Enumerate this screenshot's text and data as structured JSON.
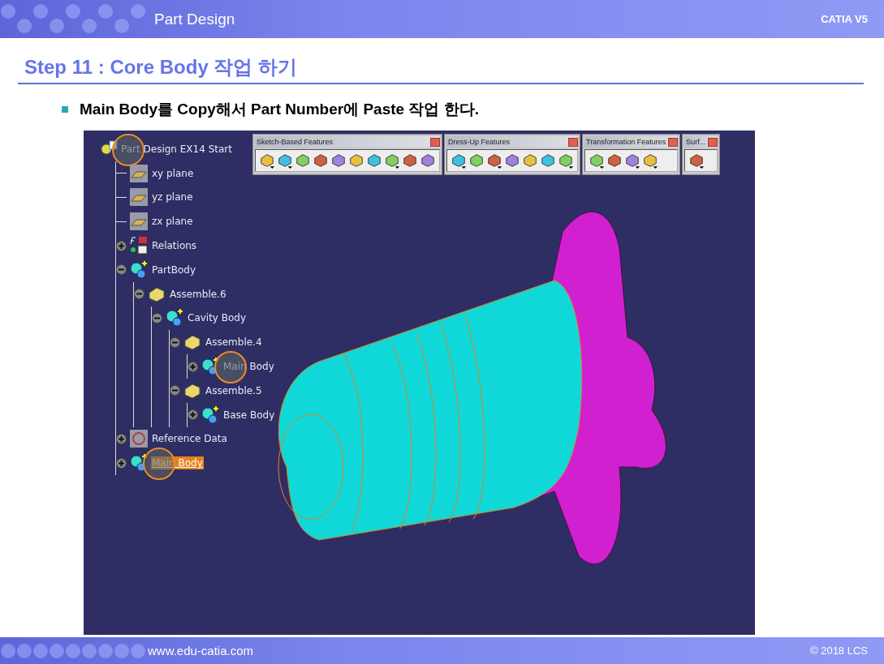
{
  "header": {
    "title": "Part Design",
    "product": "CATIA V5"
  },
  "step_title": "Step 11 : Core Body 작업 하기",
  "bullet": "Main Body를 Copy해서 Part Number에 Paste 작업 한다.",
  "toolbars": [
    {
      "title": "Sketch-Based Features",
      "tools": [
        {
          "dropdown": true
        },
        {
          "dropdown": true
        },
        {
          "dropdown": false
        },
        {
          "dropdown": false
        },
        {
          "dropdown": false
        },
        {
          "dropdown": false
        },
        {
          "dropdown": false
        },
        {
          "dropdown": true
        },
        {
          "dropdown": false
        },
        {
          "dropdown": false
        }
      ]
    },
    {
      "title": "Dress-Up Features",
      "tools": [
        {
          "dropdown": true
        },
        {
          "dropdown": false
        },
        {
          "dropdown": true
        },
        {
          "dropdown": false
        },
        {
          "dropdown": false
        },
        {
          "dropdown": false
        },
        {
          "dropdown": true
        }
      ]
    },
    {
      "title": "Transformation Features",
      "tools": [
        {
          "dropdown": true
        },
        {
          "dropdown": false
        },
        {
          "dropdown": true
        },
        {
          "dropdown": true
        }
      ]
    },
    {
      "title": "Surf...",
      "tools": [
        {
          "dropdown": true
        }
      ]
    }
  ],
  "tree": {
    "label": "Part Design EX14 Start",
    "kind": "part",
    "circled": true,
    "selected": false,
    "children": [
      {
        "label": "xy plane",
        "kind": "plane",
        "circled": false,
        "selected": false
      },
      {
        "label": "yz plane",
        "kind": "plane",
        "circled": false,
        "selected": false
      },
      {
        "label": "zx plane",
        "kind": "plane",
        "circled": false,
        "selected": false
      },
      {
        "label": "Relations",
        "kind": "relations",
        "expanded": false,
        "circled": false,
        "selected": false
      },
      {
        "label": "PartBody",
        "kind": "body",
        "expanded": true,
        "circled": false,
        "selected": false,
        "children": [
          {
            "label": "Assemble.6",
            "kind": "assemble",
            "expanded": true,
            "circled": false,
            "selected": false,
            "children": [
              {
                "label": "Cavity Body",
                "kind": "body",
                "expanded": true,
                "circled": false,
                "selected": false,
                "children": [
                  {
                    "label": "Assemble.4",
                    "kind": "assemble",
                    "expanded": true,
                    "circled": false,
                    "selected": false,
                    "children": [
                      {
                        "label": "Main Body",
                        "kind": "body",
                        "expanded": false,
                        "circled": true,
                        "selected": false
                      }
                    ]
                  },
                  {
                    "label": "Assemble.5",
                    "kind": "assemble",
                    "expanded": true,
                    "circled": false,
                    "selected": false,
                    "children": [
                      {
                        "label": "Base Body",
                        "kind": "body",
                        "expanded": false,
                        "circled": false,
                        "selected": false
                      }
                    ]
                  }
                ]
              }
            ]
          }
        ]
      },
      {
        "label": "Reference Data",
        "kind": "reference",
        "expanded": false,
        "circled": false,
        "selected": false
      },
      {
        "label": "Main Body",
        "kind": "body",
        "expanded": false,
        "circled": true,
        "selected": true
      }
    ]
  },
  "footer": {
    "url": "www.edu-catia.com",
    "copyright": "© 2018 LCS"
  }
}
